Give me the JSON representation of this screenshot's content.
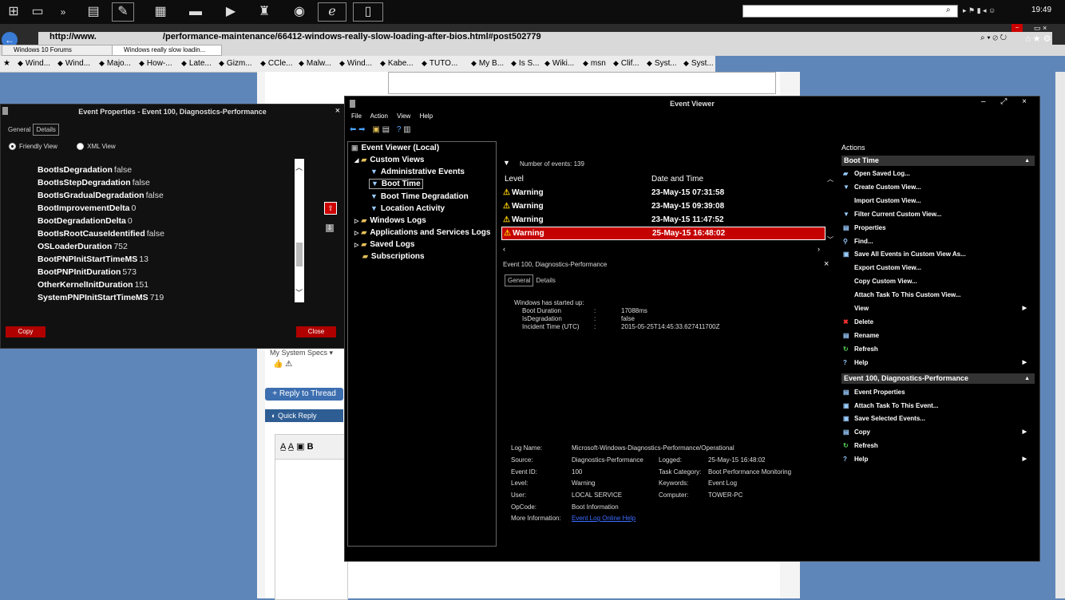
{
  "taskbar": {
    "icons": [
      "windows-icon",
      "task-view-icon",
      "chevron-icon",
      "explorer-icon",
      "tool-icon",
      "grid-icon",
      "film-icon",
      "play-icon",
      "bottle-icon",
      "chrome-icon",
      "ie-icon",
      "calc-icon"
    ],
    "clock": "19:49"
  },
  "browser": {
    "url_prefix": "http://www.",
    "url_path": "/performance-maintenance/66412-windows-really-slow-loading-after-bios.html#post502779",
    "tabs": [
      "Windows 10 Forums",
      "Windows really slow loadin..."
    ],
    "favorites": [
      "Wind...",
      "Wind...",
      "Majo...",
      "How-...",
      "Late...",
      "Gizm...",
      "CCle...",
      "Malw...",
      "Wind...",
      "Kabe...",
      "TUTO...",
      "My B...",
      "Is S...",
      "Wiki...",
      "msn",
      "Clif...",
      "Syst...",
      "Syst..."
    ]
  },
  "webpage": {
    "specs": "My System Specs",
    "reply_button": "+ Reply to Thread",
    "quick_reply": "Quick Reply"
  },
  "properties": {
    "title": "Event Properties - Event 100, Diagnostics-Performance",
    "tabs": [
      "General",
      "Details"
    ],
    "radio_friendly": "Friendly View",
    "radio_xml": "XML View",
    "rows": [
      {
        "key": "BootIsDegradation",
        "val": "false"
      },
      {
        "key": "BootIsStepDegradation",
        "val": "false"
      },
      {
        "key": "BootIsGradualDegradation",
        "val": "false"
      },
      {
        "key": "BootImprovementDelta",
        "val": "0"
      },
      {
        "key": "BootDegradationDelta",
        "val": "0"
      },
      {
        "key": "BootIsRootCauseIdentified",
        "val": "false"
      },
      {
        "key": "OSLoaderDuration",
        "val": "752"
      },
      {
        "key": "BootPNPInitStartTimeMS",
        "val": "13"
      },
      {
        "key": "BootPNPInitDuration",
        "val": "573"
      },
      {
        "key": "OtherKernelInitDuration",
        "val": "151"
      },
      {
        "key": "SystemPNPInitStartTimeMS",
        "val": "719"
      }
    ],
    "copy": "Copy",
    "close": "Close"
  },
  "viewer": {
    "title": "Event Viewer",
    "menu": [
      "File",
      "Action",
      "View",
      "Help"
    ],
    "tree": {
      "root": "Event Viewer (Local)",
      "custom_views": "Custom Views",
      "admin_events": "Administrative Events",
      "boot_time": "Boot Time",
      "boot_degradation": "Boot Time Degradation",
      "location_activity": "Location Activity",
      "windows_logs": "Windows Logs",
      "app_services": "Applications and Services Logs",
      "saved_logs": "Saved Logs",
      "subscriptions": "Subscriptions"
    },
    "events_count": "Number of events: 139",
    "col_level": "Level",
    "col_date": "Date and Time",
    "events": [
      {
        "level": "Warning",
        "date": "23-May-15 07:31:58"
      },
      {
        "level": "Warning",
        "date": "23-May-15 09:39:08"
      },
      {
        "level": "Warning",
        "date": "23-May-15 11:47:52"
      },
      {
        "level": "Warning",
        "date": "25-May-15 16:48:02"
      }
    ],
    "detail_title": "Event 100, Diagnostics-Performance",
    "detail_tabs": [
      "General",
      "Details"
    ],
    "detail_text": {
      "line1": "Windows has started up:",
      "boot_duration_k": "Boot Duration",
      "boot_duration_v": "17088ms",
      "is_degradation_k": "IsDegradation",
      "is_degradation_v": "false",
      "incident_k": "Incident Time (UTC)",
      "incident_v": "2015-05-25T14:45:33.627411700Z",
      "colon": ":"
    },
    "meta": {
      "log_name_k": "Log Name:",
      "log_name_v": "Microsoft-Windows-Diagnostics-Performance/Operational",
      "source_k": "Source:",
      "source_v": "Diagnostics-Performance",
      "logged_k": "Logged:",
      "logged_v": "25-May-15 16:48:02",
      "event_id_k": "Event ID:",
      "event_id_v": "100",
      "task_k": "Task Category:",
      "task_v": "Boot Performance Monitoring",
      "level_k": "Level:",
      "level_v": "Warning",
      "keywords_k": "Keywords:",
      "keywords_v": "Event Log",
      "user_k": "User:",
      "user_v": "LOCAL SERVICE",
      "computer_k": "Computer:",
      "computer_v": "TOWER-PC",
      "opcode_k": "OpCode:",
      "opcode_v": "Boot Information",
      "more_k": "More Information:",
      "more_v": "Event Log Online Help"
    },
    "actions": {
      "heading": "Actions",
      "section1": "Boot Time",
      "items1": [
        "Open Saved Log...",
        "Create Custom View...",
        "Import Custom View...",
        "Filter Current Custom View...",
        "Properties",
        "Find...",
        "Save All Events in Custom View As...",
        "Export Custom View...",
        "Copy Custom View...",
        "Attach Task To This Custom View...",
        "View",
        "Delete",
        "Rename",
        "Refresh",
        "Help"
      ],
      "section2": "Event 100, Diagnostics-Performance",
      "items2": [
        "Event Properties",
        "Attach Task To This Event...",
        "Save Selected Events...",
        "Copy",
        "Refresh",
        "Help"
      ]
    }
  }
}
